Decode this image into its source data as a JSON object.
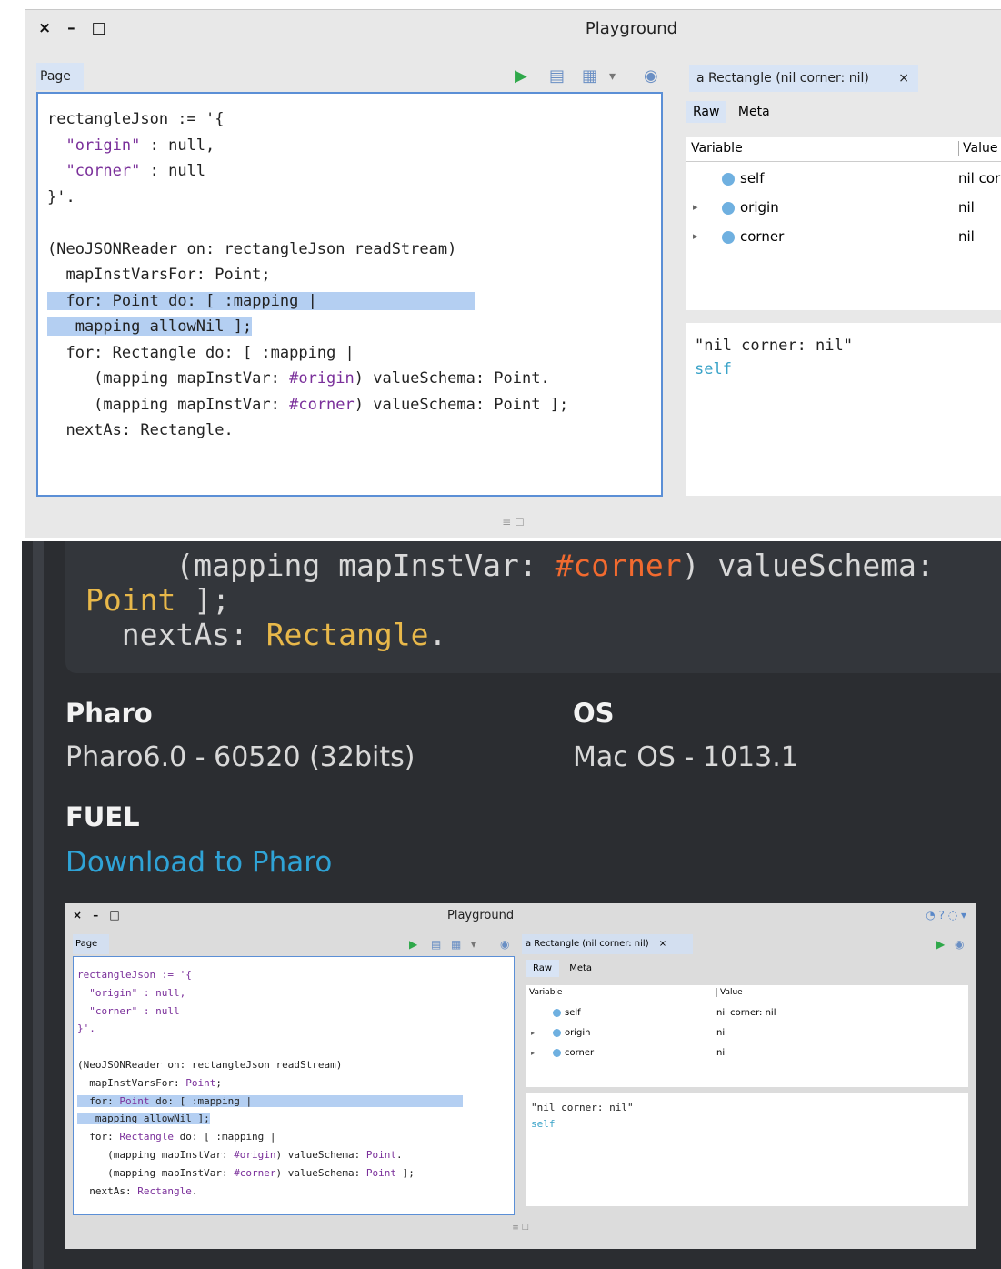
{
  "playground": {
    "window_buttons": "× – □",
    "title": "Playground",
    "page_tab": "Page",
    "inspector_tab": "a Rectangle (nil corner: nil)",
    "inspector_close": "×",
    "toolbar_play": "▶",
    "toolbar_doc": "▤",
    "toolbar_layout": "▦",
    "toolbar_dropdown": "▾",
    "toolbar_bug": "◉",
    "subtab_raw": "Raw",
    "subtab_meta": "Meta",
    "table_headers": [
      "Variable",
      "Value"
    ],
    "variables": [
      {
        "name": "self",
        "value": "nil corner: nil",
        "expandable": false
      },
      {
        "name": "origin",
        "value": "nil",
        "expandable": true
      },
      {
        "name": "corner",
        "value": "nil",
        "expandable": true
      }
    ],
    "expand_glyph": "▸",
    "eval_line1": "\"nil corner: nil\"",
    "eval_line2": "self",
    "status": "≡ ☐",
    "code": {
      "l1_a": "rectangleJson := '{",
      "l2_a": "  ",
      "l2_s": "\"origin\"",
      "l2_b": " : null,",
      "l3_a": "  ",
      "l3_s": "\"corner\"",
      "l3_b": " : null",
      "l4_a": "}'.",
      "l6_a": "(NeoJSONReader on: rectangleJson readStream)",
      "l7_a": "  mapInstVarsFor: ",
      "l7_k": "Point",
      "l7_b": ";",
      "l8_a": "  for: ",
      "l8_k": "Point",
      "l8_b": " do: [ :mapping |",
      "l9_a": "   mapping allowNil ];",
      "l10_a": "  for: ",
      "l10_k": "Rectangle",
      "l10_b": " do: [ :mapping |",
      "l11_a": "     (mapping mapInstVar: ",
      "l11_s": "#origin",
      "l11_b": ") valueSchema: ",
      "l11_k": "Point",
      "l11_c": ".",
      "l12_a": "     (mapping mapInstVar: ",
      "l12_s": "#corner",
      "l12_b": ") valueSchema: ",
      "l12_k": "Point",
      "l12_c": " ];",
      "l13_a": "  nextAs: ",
      "l13_k": "Rectangle",
      "l13_b": "."
    }
  },
  "page": {
    "code_tail": {
      "l1_a": "     (mapping mapInstVar: ",
      "l1_s": "#corner",
      "l1_b": ") valueSchema:",
      "l2_k": "Point",
      "l2_b": " ];",
      "l3_a": "  nextAs: ",
      "l3_k": "Rectangle",
      "l3_b": "."
    },
    "pharo_label": "Pharo",
    "pharo_value": "Pharo6.0 - 60520 (32bits)",
    "os_label": "OS",
    "os_value": "Mac OS - 1013.1",
    "fuel_label": "FUEL",
    "download_link": "Download to Pharo",
    "colors": {
      "background": "#2b2d31",
      "link": "#2fa3d6",
      "class_name": "#e8b84a",
      "symbol": "#f26a2f"
    }
  }
}
